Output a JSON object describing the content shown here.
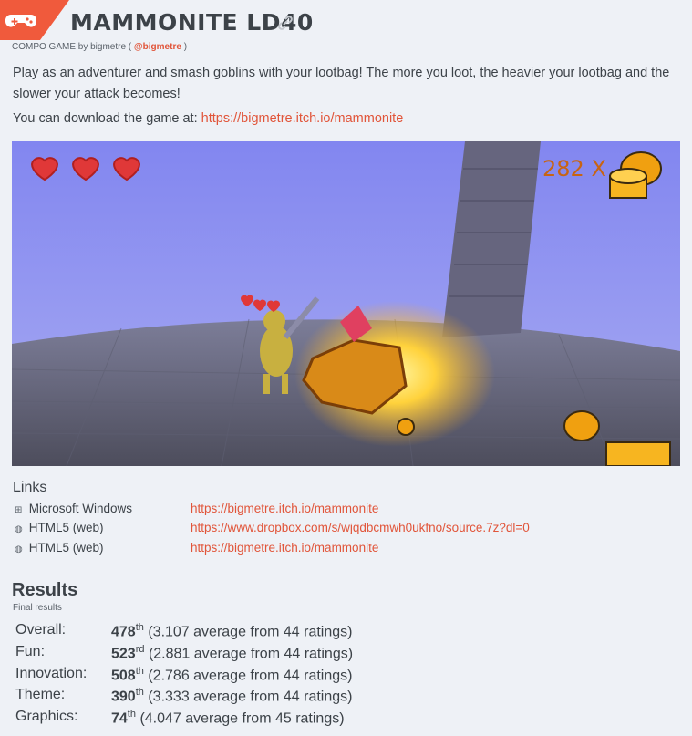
{
  "game": {
    "title": "MAMMONITE LD40",
    "byline_prefix": "COMPO GAME by bigmetre (",
    "byline_author": "@bigmetre",
    "byline_suffix": ")",
    "description": "Play as an adventurer and smash goblins with your lootbag! The more you loot, the heavier your lootbag and the slower your attack becomes!",
    "download_prefix": "You can download the game at:",
    "download_url": "https://bigmetre.itch.io/mammonite"
  },
  "screenshot": {
    "score_text": "282  X"
  },
  "links": {
    "title": "Links",
    "items": [
      {
        "icon": "windows-icon",
        "platform": "Microsoft Windows",
        "url": "https://bigmetre.itch.io/mammonite"
      },
      {
        "icon": "globe-icon",
        "platform": "HTML5 (web)",
        "url": "https://www.dropbox.com/s/wjqdbcmwh0ukfno/source.7z?dl=0"
      },
      {
        "icon": "globe-icon",
        "platform": "HTML5 (web)",
        "url": "https://bigmetre.itch.io/mammonite"
      }
    ]
  },
  "results": {
    "title": "Results",
    "subtitle": "Final results",
    "rows": [
      {
        "category": "Overall:",
        "rank": "478",
        "suffix": "th",
        "detail": "(3.107 average from 44 ratings)"
      },
      {
        "category": "Fun:",
        "rank": "523",
        "suffix": "rd",
        "detail": "(2.881 average from 44 ratings)"
      },
      {
        "category": "Innovation:",
        "rank": "508",
        "suffix": "th",
        "detail": "(2.786 average from 44 ratings)"
      },
      {
        "category": "Theme:",
        "rank": "390",
        "suffix": "th",
        "detail": "(3.333 average from 44 ratings)"
      },
      {
        "category": "Graphics:",
        "rank": "74",
        "suffix": "th",
        "detail": "(4.047 average from 45 ratings)"
      }
    ]
  },
  "colors": {
    "accent": "#e1553a",
    "badge": "#f05a3c",
    "background": "#eef1f6"
  }
}
